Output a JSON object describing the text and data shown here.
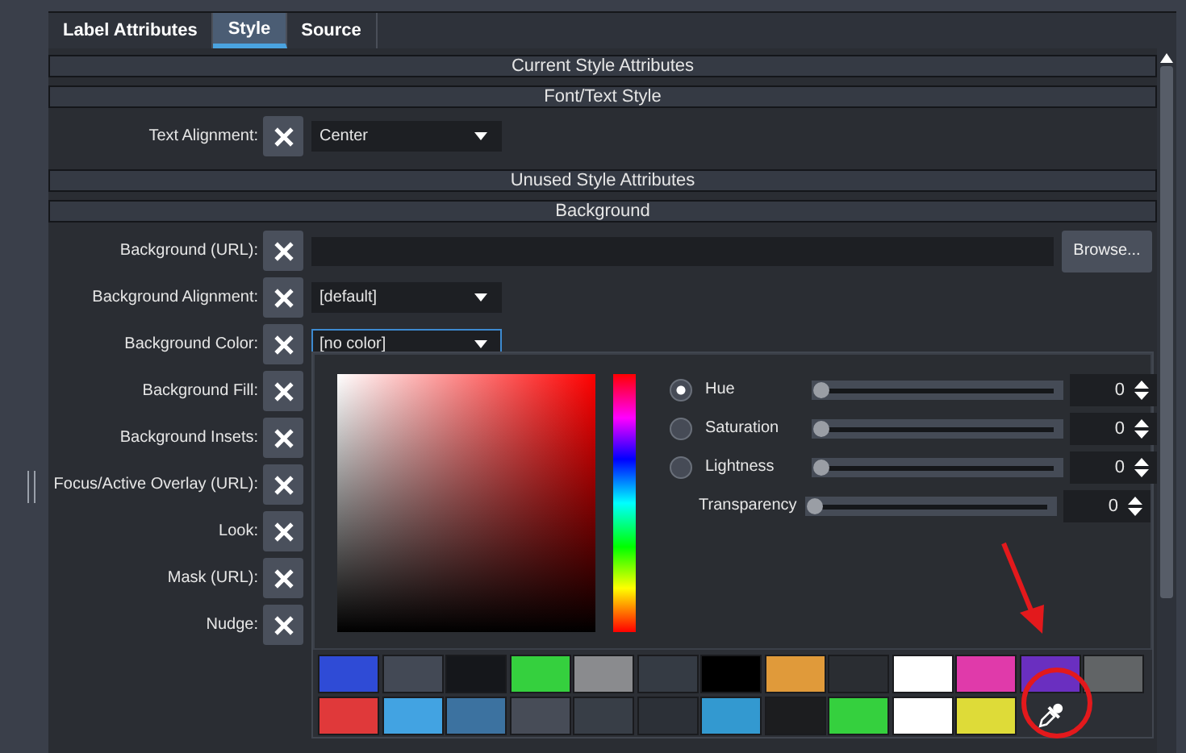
{
  "tabs": [
    {
      "label": "Label Attributes",
      "selected": false
    },
    {
      "label": "Style",
      "selected": true
    },
    {
      "label": "Source",
      "selected": false
    }
  ],
  "sections": [
    {
      "kind": "header",
      "title": "Current Style Attributes"
    },
    {
      "kind": "header",
      "title": "Font/Text Style"
    },
    {
      "kind": "row",
      "label": "Text Alignment:",
      "field": {
        "kind": "dropdown",
        "value": "Center",
        "focused": false
      }
    },
    {
      "kind": "header",
      "title": "Unused Style Attributes"
    },
    {
      "kind": "header",
      "title": "Background"
    },
    {
      "kind": "row",
      "label": "Background (URL):",
      "field": {
        "kind": "url",
        "button": "Browse..."
      }
    },
    {
      "kind": "row",
      "label": "Background Alignment:",
      "field": {
        "kind": "dropdown",
        "value": "[default]",
        "focused": false
      }
    },
    {
      "kind": "row",
      "label": "Background Color:",
      "field": {
        "kind": "dropdown",
        "value": "[no color]",
        "focused": true
      }
    },
    {
      "kind": "row",
      "label": "Background Fill:"
    },
    {
      "kind": "row",
      "label": "Background Insets:"
    },
    {
      "kind": "row",
      "label": "Focus/Active Overlay (URL):"
    },
    {
      "kind": "row",
      "label": "Look:"
    },
    {
      "kind": "row",
      "label": "Mask (URL):"
    },
    {
      "kind": "row",
      "label": "Nudge:"
    }
  ],
  "color_picker": {
    "channels": [
      {
        "kind": "radio",
        "label": "Hue",
        "selected": true,
        "level": 0,
        "value": "0"
      },
      {
        "kind": "radio",
        "label": "Saturation",
        "selected": false,
        "level": 0,
        "value": "0"
      },
      {
        "kind": "radio",
        "label": "Lightness",
        "selected": false,
        "level": 0,
        "value": "0"
      },
      {
        "kind": "plain",
        "label": "Transparency",
        "level": 0,
        "value": "0"
      }
    ],
    "swatch_rows": [
      [
        {
          "color": "#2f4bd6"
        },
        {
          "color": "#434955"
        },
        {
          "color": "#15171b"
        },
        {
          "color": "#35d03e"
        },
        {
          "color": "#8a8b8e"
        },
        {
          "color": "#353b44"
        },
        {
          "color": "#000000"
        },
        {
          "color": "#e09a3a"
        },
        {
          "color": "#2a2d32"
        },
        {
          "color": "#ffffff"
        },
        {
          "color": "#e03aaa"
        },
        {
          "color": "#6a2fc0"
        },
        {
          "color": "#616466"
        }
      ],
      [
        {
          "color": "#e0393a"
        },
        {
          "color": "#42a3e2"
        },
        {
          "color": "#3c72a0"
        },
        {
          "color": "#474c57"
        },
        {
          "color": "#383e47"
        },
        {
          "color": "#2c3037"
        },
        {
          "color": "#3399d0"
        },
        {
          "color": "#1c1d1f"
        },
        {
          "color": "#35d03e"
        },
        {
          "color": "#ffffff"
        },
        {
          "color": "#dedb38"
        }
      ]
    ]
  }
}
